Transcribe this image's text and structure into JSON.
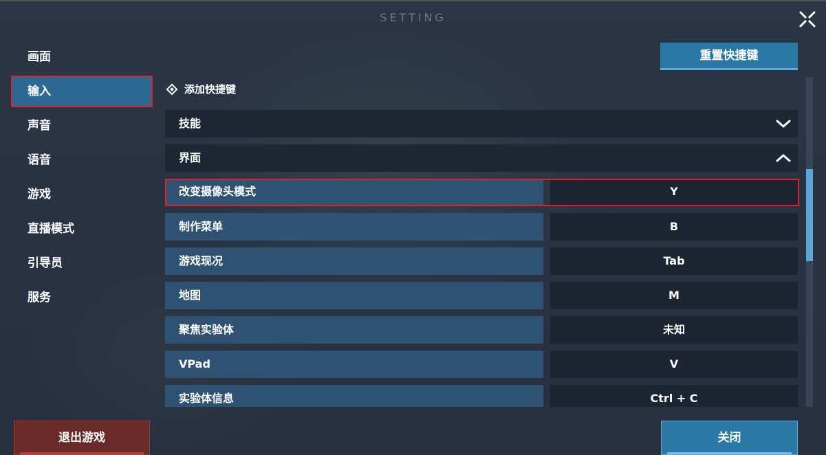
{
  "header": {
    "title": "SETTING"
  },
  "sidebar": {
    "items": [
      {
        "label": "画面",
        "active": false
      },
      {
        "label": "输入",
        "active": true
      },
      {
        "label": "声音",
        "active": false
      },
      {
        "label": "语音",
        "active": false
      },
      {
        "label": "游戏",
        "active": false
      },
      {
        "label": "直播模式",
        "active": false
      },
      {
        "label": "引导员",
        "active": false
      },
      {
        "label": "服务",
        "active": false
      }
    ]
  },
  "main": {
    "reset_label": "重置快捷键",
    "add_label": "添加快捷键",
    "groups": [
      {
        "label": "技能",
        "expanded": false
      },
      {
        "label": "界面",
        "expanded": true
      }
    ],
    "bindings": [
      {
        "action": "改变摄像头模式",
        "key": "Y",
        "highlighted": true
      },
      {
        "action": "制作菜单",
        "key": "B"
      },
      {
        "action": "游戏现况",
        "key": "Tab"
      },
      {
        "action": "地图",
        "key": "M"
      },
      {
        "action": "聚焦实验体",
        "key": "未知"
      },
      {
        "action": "VPad",
        "key": "V"
      },
      {
        "action": "实验体信息",
        "key": "Ctrl + C"
      }
    ]
  },
  "footer": {
    "exit_label": "退出游戏",
    "close_label": "关闭"
  },
  "colors": {
    "accent": "#2a78a6",
    "highlight": "#d9242c",
    "danger": "#6b2a2a"
  }
}
